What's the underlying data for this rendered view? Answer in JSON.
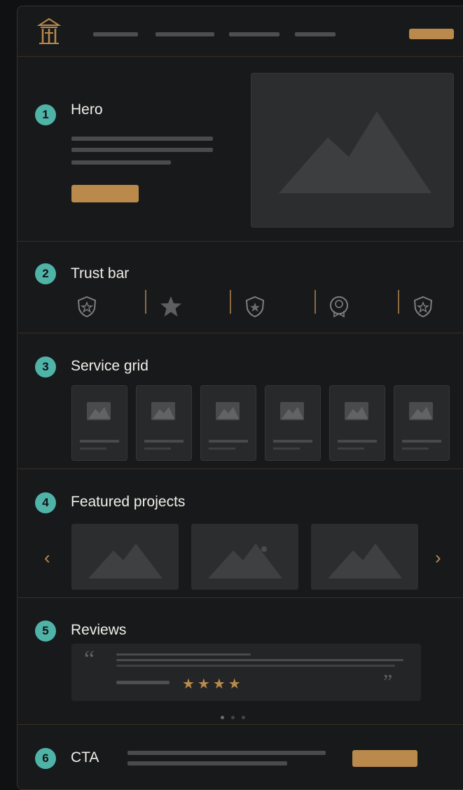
{
  "sections": [
    {
      "number": "1",
      "title": "Hero"
    },
    {
      "number": "2",
      "title": "Trust bar"
    },
    {
      "number": "3",
      "title": "Service grid"
    },
    {
      "number": "4",
      "title": "Featured projects"
    },
    {
      "number": "5",
      "title": "Reviews"
    },
    {
      "number": "6",
      "title": "CTA"
    }
  ],
  "nav": {
    "logo_icon": "temple-logo-icon",
    "items": 4
  },
  "trust_icons": [
    "shield-star-icon",
    "star-icon",
    "shield-star-icon",
    "award-badge-icon",
    "shield-star-icon"
  ],
  "carousel": {
    "prev": "‹",
    "next": "›"
  },
  "review": {
    "open_quote": "“",
    "close_quote": "”",
    "stars": "★★★★"
  },
  "colors": {
    "accent_gold": "#b98a4c",
    "badge_teal": "#4fb3a8",
    "background": "#18191a"
  }
}
